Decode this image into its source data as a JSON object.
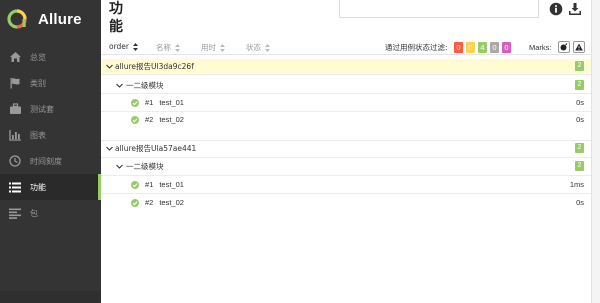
{
  "brand": {
    "name": "Allure"
  },
  "nav": [
    {
      "label": "总览",
      "icon": "home-icon"
    },
    {
      "label": "类别",
      "icon": "flag-icon"
    },
    {
      "label": "测试套",
      "icon": "briefcase-icon"
    },
    {
      "label": "图表",
      "icon": "bar-chart-icon"
    },
    {
      "label": "时间刻度",
      "icon": "clock-icon"
    },
    {
      "label": "功能",
      "icon": "list-icon",
      "active": true
    },
    {
      "label": "包",
      "icon": "align-left-icon"
    }
  ],
  "page": {
    "title": "功能"
  },
  "toolbar": {
    "sort": [
      {
        "label": "order"
      },
      {
        "label": "名称"
      },
      {
        "label": "用时"
      },
      {
        "label": "状态"
      }
    ],
    "filter_label": "通过用例状态过滤:",
    "status_counts": [
      {
        "value": "0",
        "color": "#fd5a3e"
      },
      {
        "value": "0",
        "color": "#ffd050"
      },
      {
        "value": "4",
        "color": "#97cc64"
      },
      {
        "value": "0",
        "color": "#aaaaaa"
      },
      {
        "value": "0",
        "color": "#d35ebe"
      }
    ],
    "marks_label": "Marks:"
  },
  "groups": [
    {
      "name": "allure报告Ul3da9c26f",
      "count": "2",
      "highlighted": true,
      "sub": {
        "name": "一二级模块",
        "count": "2",
        "tests": [
          {
            "num": "#1",
            "name": "test_01",
            "duration": "0s"
          },
          {
            "num": "#2",
            "name": "test_02",
            "duration": "0s"
          }
        ]
      }
    },
    {
      "name": "allure报告Ula57ae441",
      "count": "2",
      "highlighted": false,
      "sub": {
        "name": "一二级模块",
        "count": "2",
        "tests": [
          {
            "num": "#1",
            "name": "test_01",
            "duration": "1ms"
          },
          {
            "num": "#2",
            "name": "test_02",
            "duration": "0s"
          }
        ]
      }
    }
  ]
}
